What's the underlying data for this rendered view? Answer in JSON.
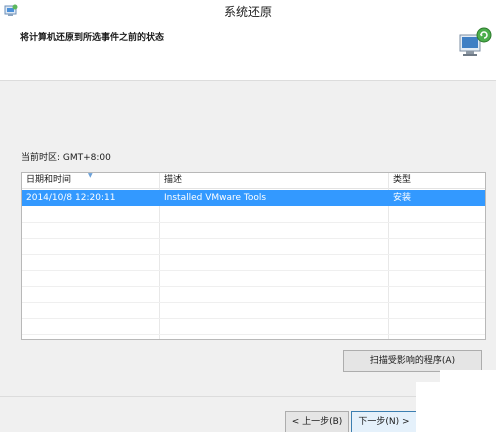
{
  "window": {
    "title": "系统还原"
  },
  "header": {
    "instruction": "将计算机还原到所选事件之前的状态"
  },
  "timezone": {
    "label": "当前时区: GMT+8:00"
  },
  "table": {
    "columns": [
      "日期和时间",
      "描述",
      "类型"
    ],
    "rows": [
      {
        "datetime": "2014/10/8 12:20:11",
        "description": "Installed VMware Tools",
        "type": "安装",
        "selected": true
      }
    ]
  },
  "buttons": {
    "scan": "扫描受影响的程序(A)",
    "back": "< 上一步(B)",
    "next": "下一步(N) >"
  },
  "icons": {
    "title": "system-restore-icon",
    "header": "computer-restore-icon"
  },
  "colors": {
    "selection": "#3399ff",
    "window_bg": "#f0f0f0"
  }
}
